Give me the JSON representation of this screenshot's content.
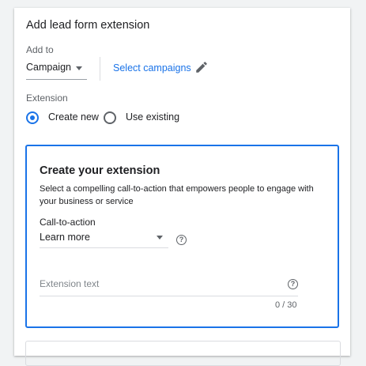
{
  "panel": {
    "title": "Add lead form extension",
    "add_to_label": "Add to",
    "add_to_value": "Campaign",
    "select_link": "Select campaigns",
    "extension_label": "Extension",
    "radio_options": [
      {
        "label": "Create new",
        "selected": true
      },
      {
        "label": "Use existing",
        "selected": false
      }
    ]
  },
  "extension_card": {
    "title": "Create your extension",
    "description": "Select a compelling call-to-action that empowers people to engage with your business or service",
    "cta_label": "Call-to-action",
    "cta_value": "Learn more",
    "text_placeholder": "Extension text",
    "counter": "0 / 30"
  },
  "icons": {
    "pencil": "pencil-icon",
    "help": "help-icon",
    "caret": "chevron-down-icon"
  },
  "colors": {
    "accent": "#1a73e8",
    "text": "#202124",
    "muted": "#5f6368"
  }
}
